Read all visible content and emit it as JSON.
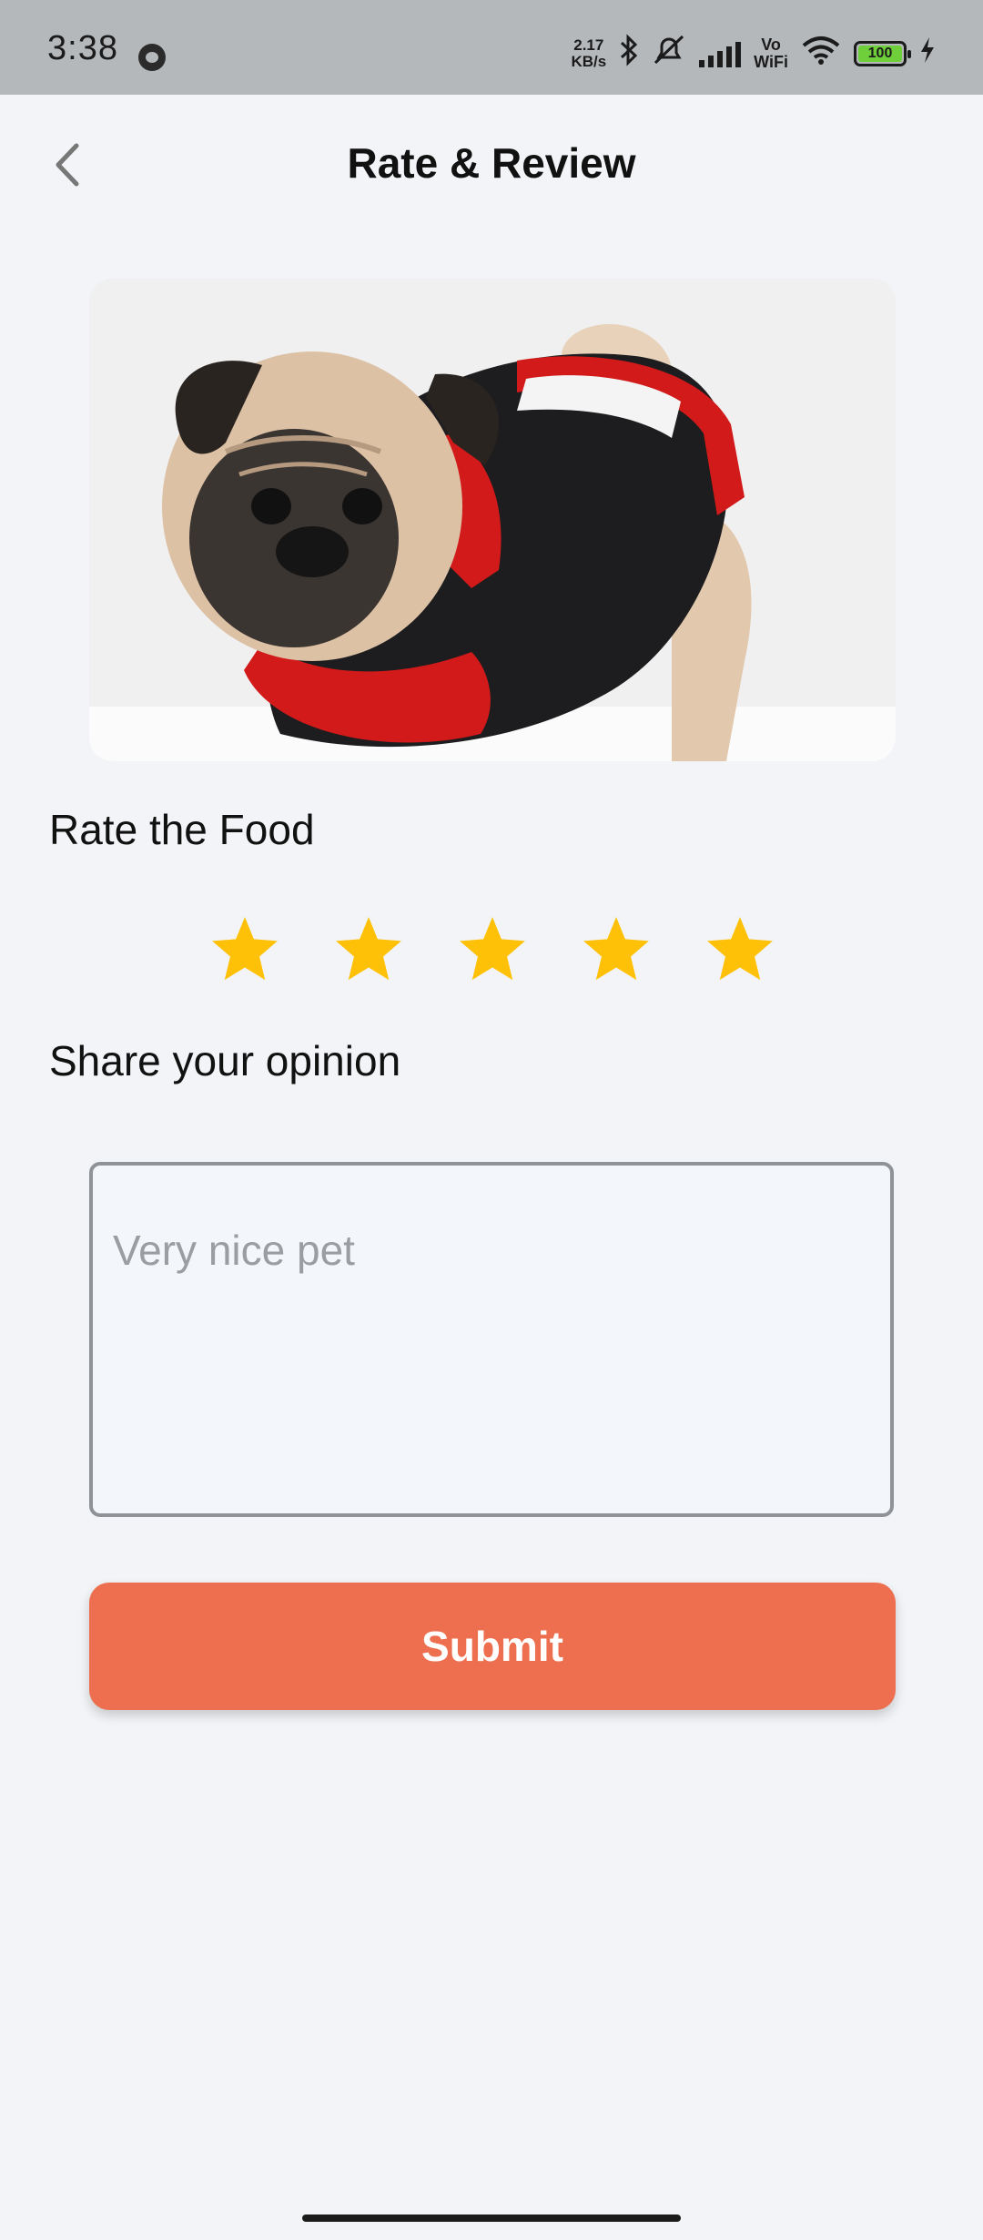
{
  "status_bar": {
    "time": "3:38",
    "net_speed_value": "2.17",
    "net_speed_unit": "KB/s",
    "vowifi_top": "Vo",
    "vowifi_bottom": "WiFi",
    "battery": "100",
    "icons": [
      "face-icon",
      "bluetooth-icon",
      "mute-icon",
      "signal-icon",
      "wifi-icon",
      "battery-icon",
      "charging-icon"
    ]
  },
  "header": {
    "title": "Rate & Review",
    "back_icon": "chevron-left-icon"
  },
  "product_image": {
    "subject": "pug-in-sweater-photo"
  },
  "rating": {
    "label": "Rate the Food",
    "stars_filled": 5,
    "stars_total": 5,
    "star_color": "#ffc107"
  },
  "review": {
    "label": "Share your opinion",
    "text": "Very nice pet"
  },
  "submit": {
    "label": "Submit",
    "color": "#ee6f4f"
  }
}
